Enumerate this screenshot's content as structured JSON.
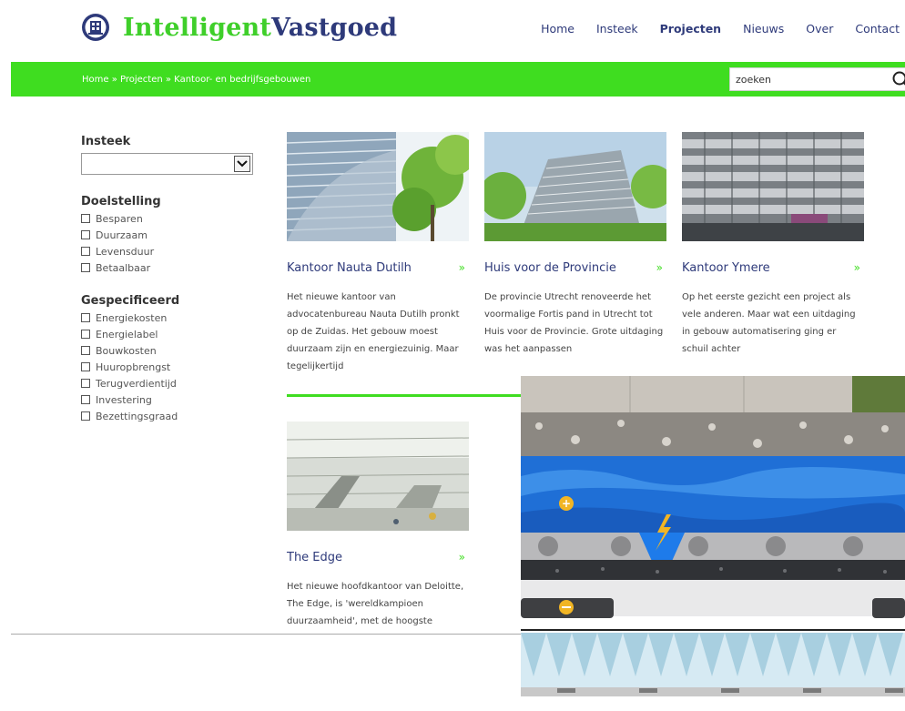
{
  "header": {
    "logo_part1": "Intelligent",
    "logo_part2": "Vastgoed",
    "nav": [
      {
        "label": "Home",
        "active": false
      },
      {
        "label": "Insteek",
        "active": false
      },
      {
        "label": "Projecten",
        "active": true
      },
      {
        "label": "Nieuws",
        "active": false
      },
      {
        "label": "Over",
        "active": false
      },
      {
        "label": "Contact",
        "active": false
      }
    ]
  },
  "bar": {
    "breadcrumb": "Home » Projecten » Kantoor- en bedrijfsgebouwen",
    "search_value": "zoeken"
  },
  "sidebar": {
    "insteek_heading": "Insteek",
    "insteek_selected": "",
    "doelstelling_heading": "Doelstelling",
    "doelstelling_items": [
      "Besparen",
      "Duurzaam",
      "Levensduur",
      "Betaalbaar"
    ],
    "gespecificeerd_heading": "Gespecificeerd",
    "gespecificeerd_items": [
      "Energiekosten",
      "Energielabel",
      "Bouwkosten",
      "Huuropbrengst",
      "Terugverdientijd",
      "Investering",
      "Bezettingsgraad"
    ]
  },
  "projects": [
    {
      "title": "Kantoor Nauta Dutilh",
      "more": "»",
      "description": "Het nieuwe kantoor van advocatenbureau Nauta Dutilh pronkt op de Zuidas. Het gebouw moest duurzaam zijn en energiezuinig. Maar tegelijkertijd"
    },
    {
      "title": "Huis voor de Provincie",
      "more": "»",
      "description": "De provincie Utrecht renoveerde het voormalige Fortis pand in Utrecht tot Huis voor de Provincie. Grote uitdaging was het aanpassen"
    },
    {
      "title": "Kantoor Ymere",
      "more": "»",
      "description": "Op het eerste gezicht een project als vele anderen. Maar wat een uitdaging in gebouw automatisering ging er schuil achter"
    },
    {
      "title": "The Edge",
      "more": "»",
      "description": "Het nieuwe hoofdkantoor van Deloitte, The Edge, is 'wereldkampioen duurzaamheid', met de hoogste"
    }
  ],
  "colors": {
    "brand_green": "#3fdd20",
    "brand_navy": "#2e3a7a"
  },
  "icons": {
    "logo": "building-globe-icon",
    "search": "magnifier-icon",
    "select_arrow": "chevron-down-icon"
  }
}
